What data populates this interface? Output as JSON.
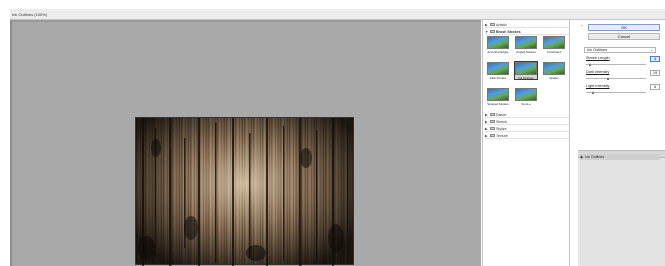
{
  "window": {
    "title": "Ink Outlines (100%)"
  },
  "gallery": {
    "folders_top": [
      {
        "label": "Artistic",
        "expanded": false
      },
      {
        "label": "Brush Strokes",
        "expanded": true
      }
    ],
    "thumbnails": [
      {
        "label": "Accented Edges",
        "selected": false
      },
      {
        "label": "Angled Strokes",
        "selected": false
      },
      {
        "label": "Crosshatch",
        "selected": false
      },
      {
        "label": "Dark Strokes",
        "selected": false
      },
      {
        "label": "Ink Outlines",
        "selected": true
      },
      {
        "label": "Spatter",
        "selected": false
      },
      {
        "label": "Sprayed Strokes",
        "selected": false
      },
      {
        "label": "Sumi-e",
        "selected": false
      }
    ],
    "folders_bottom": [
      {
        "label": "Distort",
        "expanded": false
      },
      {
        "label": "Sketch",
        "expanded": false
      },
      {
        "label": "Stylize",
        "expanded": false
      },
      {
        "label": "Texture",
        "expanded": false
      }
    ]
  },
  "controls": {
    "ok_label": "OK",
    "cancel_label": "Cancel",
    "filter_select": "Ink Outlines",
    "params": [
      {
        "label": "Stroke Length",
        "value": "4",
        "slider": 0.08
      },
      {
        "label": "Dark Intensity",
        "value": "19",
        "slider": 0.38
      },
      {
        "label": "Light Intensity",
        "value": "6",
        "slider": 0.12
      }
    ]
  },
  "layers": {
    "items": [
      {
        "label": "Ink Outlines"
      }
    ]
  }
}
